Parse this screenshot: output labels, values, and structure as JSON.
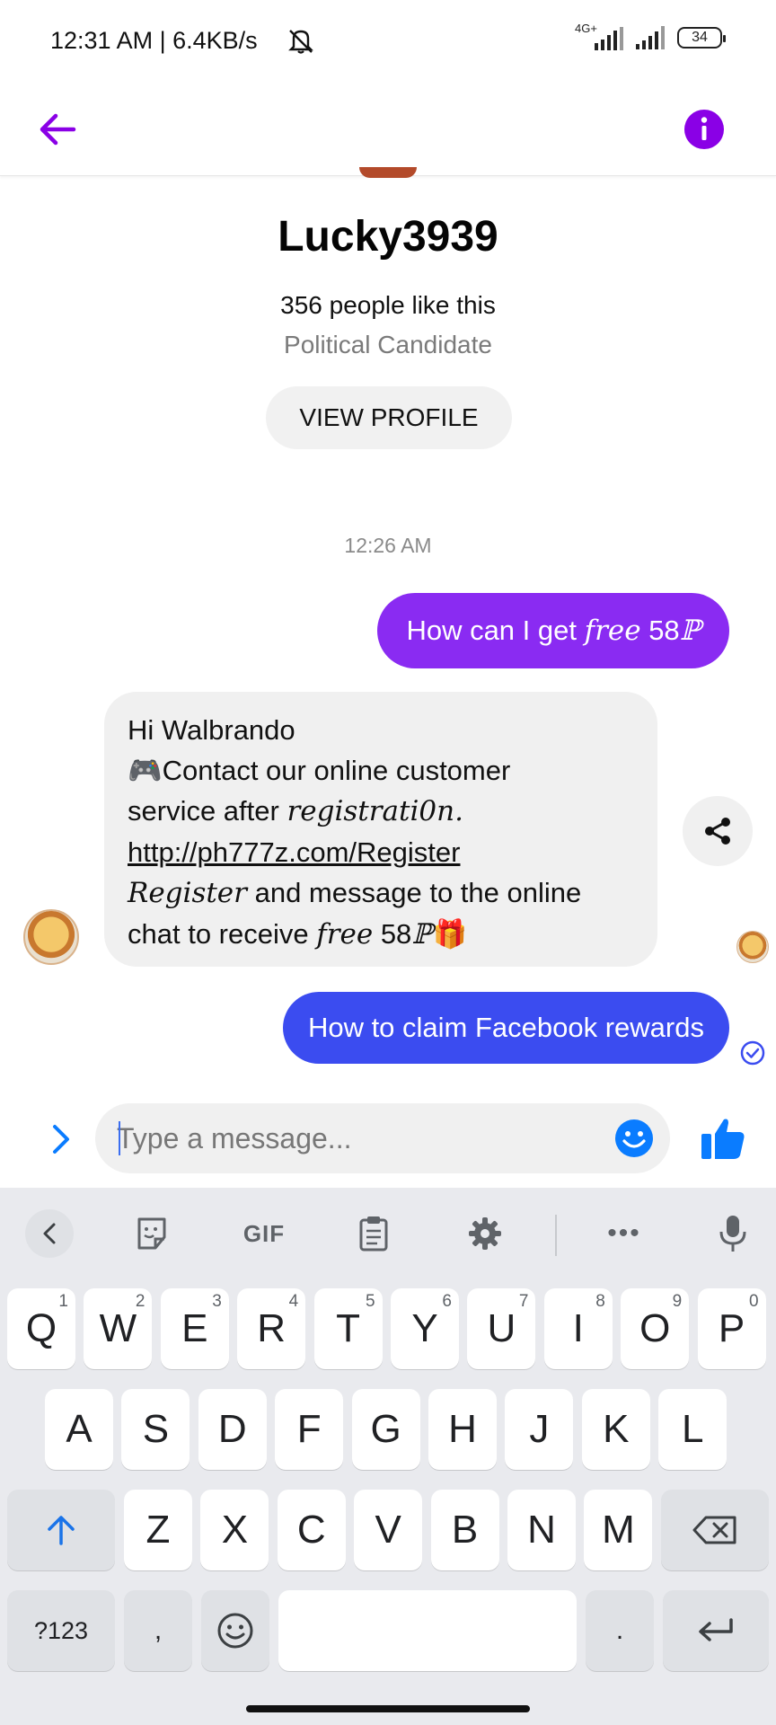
{
  "status_bar": {
    "time": "12:31 AM | 6.4KB/s",
    "network_label": "4G+",
    "battery": "34"
  },
  "profile": {
    "name": "Lucky3939",
    "likes": "356 people like this",
    "category": "Political Candidate",
    "view_profile_label": "VIEW PROFILE"
  },
  "conversation": {
    "timestamp": "12:26 AM",
    "message_out_1": {
      "text": "How can I get ",
      "script": "free",
      "suffix": " 58",
      "script_end": "ℙ"
    },
    "message_in": {
      "line1": "Hi Walbrando",
      "line2_emoji": "🎮",
      "line2": "Contact our online customer",
      "line3": "service after ",
      "line3_script": "registrati0n.",
      "line4_link": "http://ph777z.com/Register",
      "line5_script": "Register",
      "line5": " and message to the online",
      "line6": "chat to receive ",
      "line6_script": "free",
      "line6_suffix": " 58",
      "line6_script_end": "ℙ",
      "line6_emoji": "🎁"
    },
    "message_out_2": "How to claim Facebook rewards"
  },
  "composer": {
    "placeholder": "Type a message..."
  },
  "keyboard": {
    "toolbar": {
      "gif": "GIF",
      "more": "•••"
    },
    "row1": [
      {
        "k": "Q",
        "h": "1"
      },
      {
        "k": "W",
        "h": "2"
      },
      {
        "k": "E",
        "h": "3"
      },
      {
        "k": "R",
        "h": "4"
      },
      {
        "k": "T",
        "h": "5"
      },
      {
        "k": "Y",
        "h": "6"
      },
      {
        "k": "U",
        "h": "7"
      },
      {
        "k": "I",
        "h": "8"
      },
      {
        "k": "O",
        "h": "9"
      },
      {
        "k": "P",
        "h": "0"
      }
    ],
    "row2": [
      "A",
      "S",
      "D",
      "F",
      "G",
      "H",
      "J",
      "K",
      "L"
    ],
    "row3": [
      "Z",
      "X",
      "C",
      "V",
      "B",
      "N",
      "M"
    ],
    "symbols": "?123",
    "comma": ",",
    "period": "."
  },
  "colors": {
    "accent_purple": "#8a2bf2",
    "bubble_blue": "#3b4cf0",
    "messenger_blue": "#0a7cff"
  },
  "icons": {
    "back": "arrow-left-icon",
    "info": "info-icon",
    "share": "share-icon",
    "sent": "sent-check-icon",
    "expand": "chevron-right-icon",
    "emoji": "emoji-smile-icon",
    "like": "thumbs-up-icon"
  }
}
